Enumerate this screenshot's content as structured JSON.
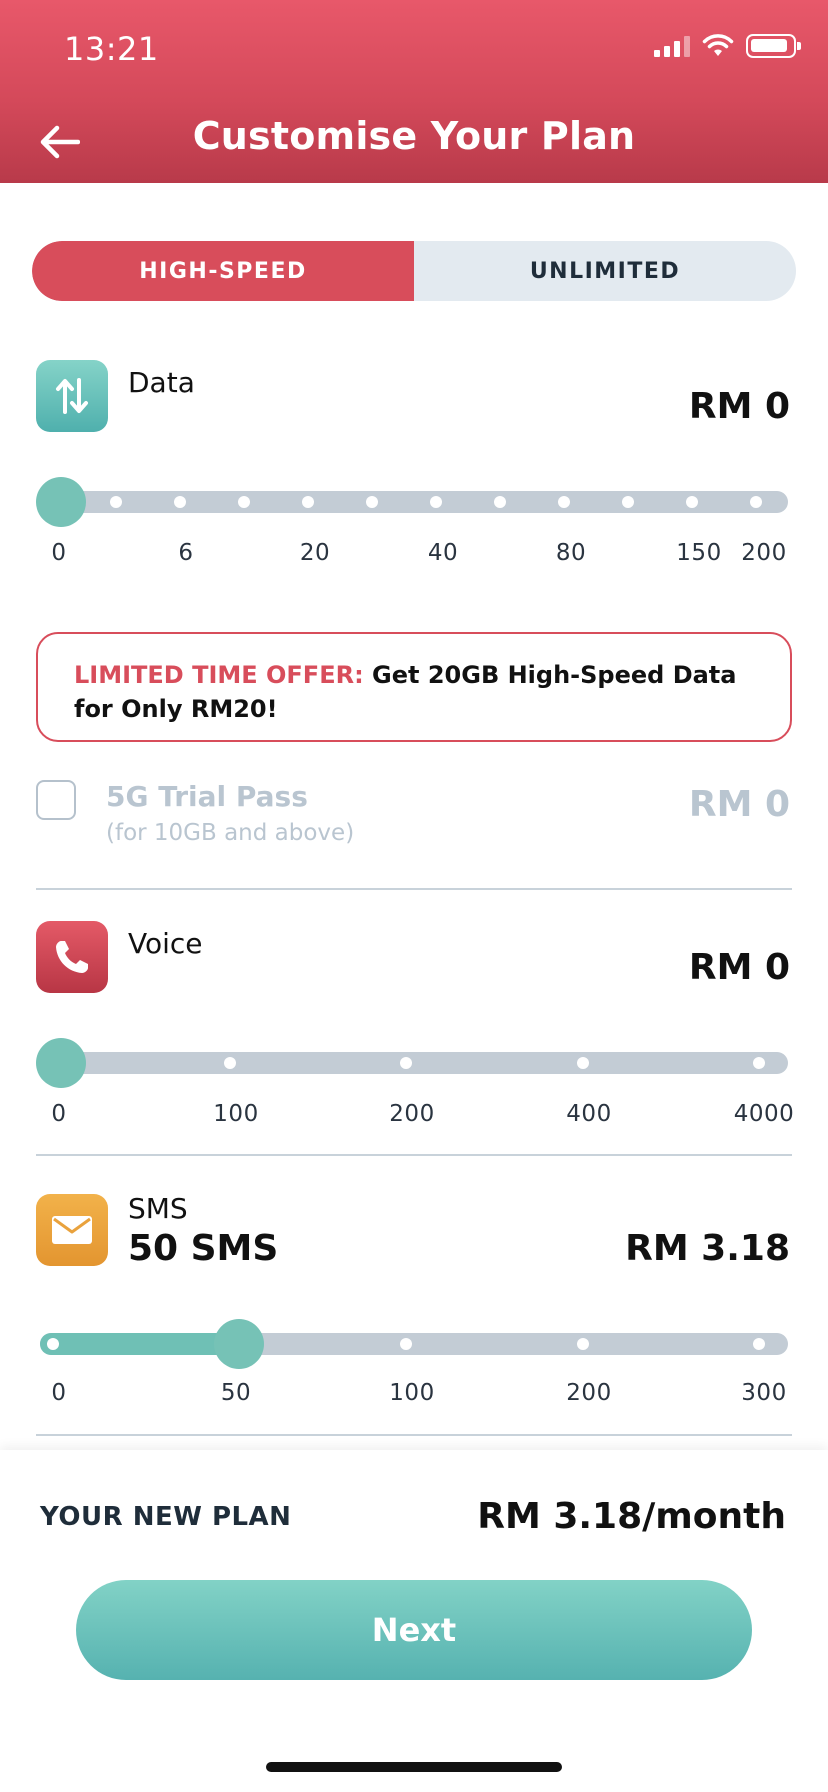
{
  "status_bar": {
    "time": "13:21"
  },
  "header": {
    "title": "Customise Your Plan"
  },
  "tabs": [
    {
      "label": "HIGH-SPEED",
      "active": true
    },
    {
      "label": "UNLIMITED",
      "active": false
    }
  ],
  "data": {
    "label": "Data",
    "price": "RM 0",
    "ticks": [
      "0",
      "6",
      "20",
      "40",
      "80",
      "150",
      "200"
    ],
    "selected": "0"
  },
  "offer": {
    "highlight": "LIMITED TIME OFFER:",
    "text": " Get 20GB High-Speed Data for Only RM20!"
  },
  "trial": {
    "title": "5G Trial Pass",
    "note": "(for 10GB and above)",
    "price": "RM 0",
    "checked": false
  },
  "voice": {
    "label": "Voice",
    "price": "RM 0",
    "ticks": [
      "0",
      "100",
      "200",
      "400",
      "4000"
    ],
    "selected": "0"
  },
  "sms": {
    "label": "SMS",
    "selection": "50 SMS",
    "price": "RM 3.18",
    "ticks": [
      "0",
      "50",
      "100",
      "200",
      "300"
    ],
    "selected": "50"
  },
  "footer": {
    "plan_label": "YOUR NEW PLAN",
    "plan_price": "RM 3.18/month",
    "next_label": "Next"
  },
  "colors": {
    "brand_red": "#d84d5b",
    "teal": "#6fc0b5",
    "track": "#c3ccd5"
  }
}
